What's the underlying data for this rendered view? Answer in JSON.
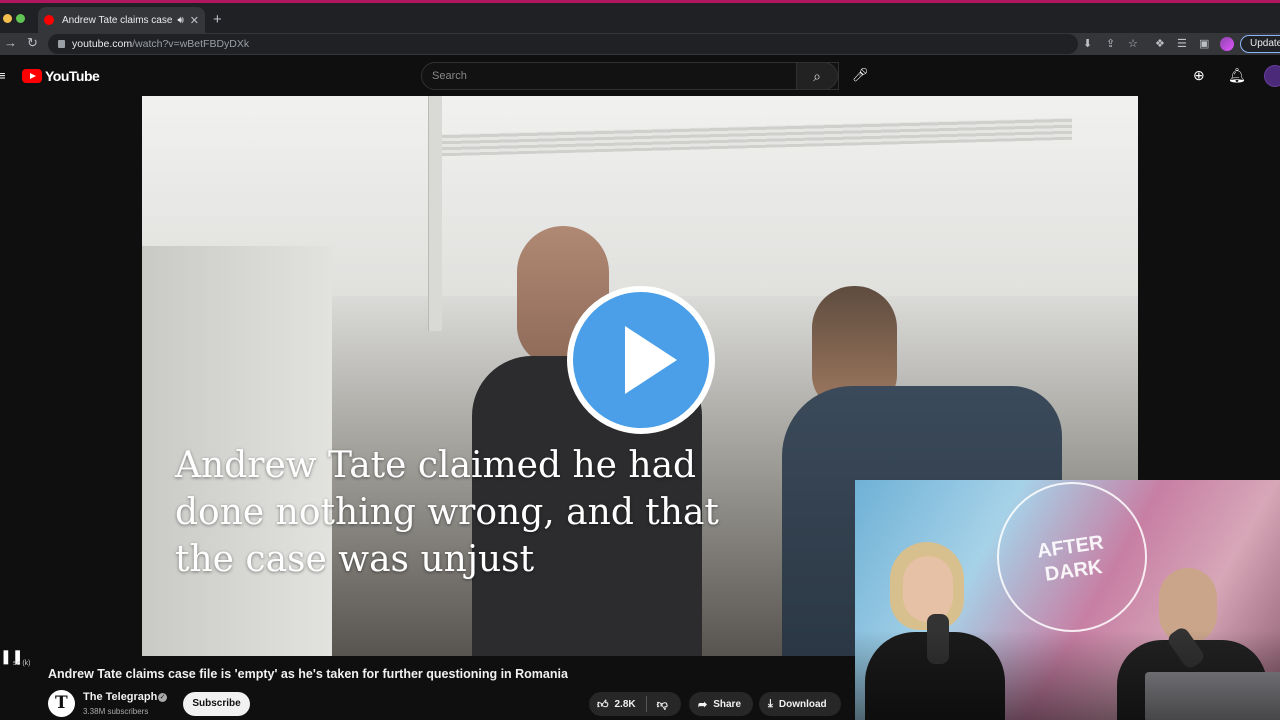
{
  "browser": {
    "tab_title": "Andrew Tate claims case file",
    "new_tab": "+",
    "url_host": "youtube.com",
    "url_path": "/watch?v=wBetFBDyDXk",
    "update_label": "Update"
  },
  "youtube": {
    "logo_text": "YouTube",
    "search_placeholder": "Search"
  },
  "video": {
    "caption_line1": "Andrew Tate claimed he had",
    "caption_line2": "done nothing wrong, and that",
    "caption_line3": "the case was unjust",
    "pip_logo_line1": "AFTER",
    "pip_logo_line2": "DARK",
    "kbd_hint": "se (k)",
    "title": "Andrew Tate claims case file is 'empty' as he's taken for further questioning in Romania"
  },
  "channel": {
    "name": "The Telegraph",
    "subscribers": "3.38M subscribers",
    "subscribe_label": "Subscribe"
  },
  "actions": {
    "like_count": "2.8K",
    "share_label": "Share",
    "download_label": "Download"
  },
  "colors": {
    "accent_red": "#ff0000",
    "play_blue": "#4a9fe8",
    "update_border": "#8ab4f8"
  }
}
